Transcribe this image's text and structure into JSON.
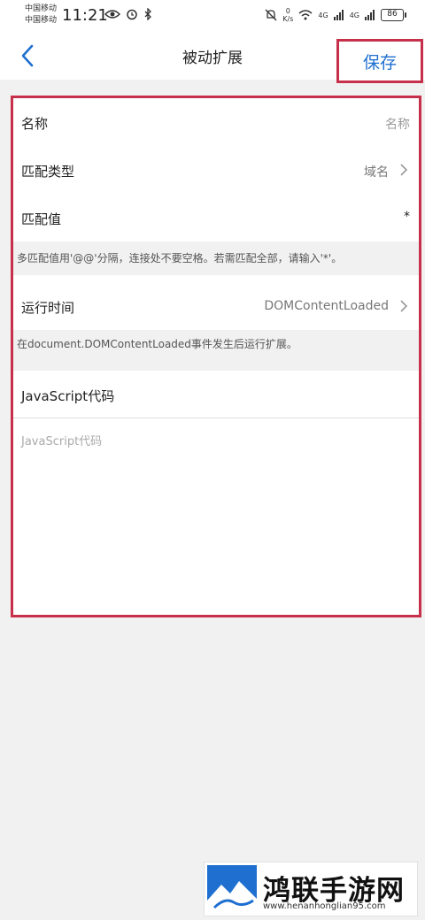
{
  "status_bar": {
    "carrier1": "中国移动",
    "carrier2": "中国移动",
    "time": "11:21",
    "speed_value": "0",
    "speed_unit": "K/s",
    "net1": "4G",
    "net2": "4G",
    "battery": "86"
  },
  "header": {
    "title": "被动扩展",
    "save_label": "保存"
  },
  "form": {
    "name": {
      "label": "名称",
      "placeholder": "名称"
    },
    "match_type": {
      "label": "匹配类型",
      "value": "域名"
    },
    "match_value": {
      "label": "匹配值",
      "value": "*"
    },
    "match_hint": "多匹配值用'@@'分隔，连接处不要空格。若需匹配全部，请输入'*'。",
    "run_time": {
      "label": "运行时间",
      "value": "DOMContentLoaded"
    },
    "run_hint": "在document.DOMContentLoaded事件发生后运行扩展。",
    "code": {
      "label": "JavaScript代码",
      "placeholder": "JavaScript代码"
    }
  },
  "watermark": {
    "title": "鸿联手游网",
    "url": "www.henanhonglian95.com"
  },
  "colors": {
    "accent": "#1f6fd0",
    "highlight_border": "#c7304a",
    "background": "#f1f1f1"
  }
}
